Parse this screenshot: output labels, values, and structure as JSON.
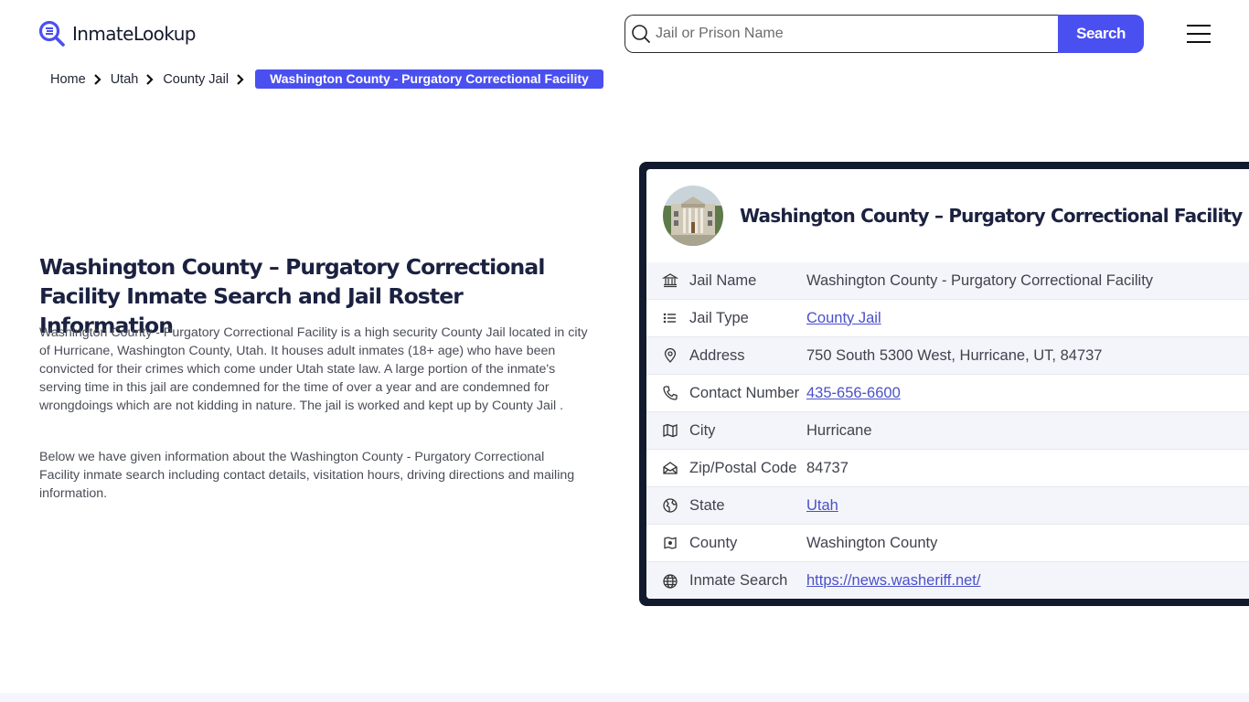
{
  "header": {
    "logo_text": "InmateLookup",
    "search_placeholder": "Jail or Prison Name",
    "search_value": "",
    "search_button": "Search",
    "brand_color": "#4a50f0"
  },
  "breadcrumb": {
    "items": [
      "Home",
      "Utah",
      "County Jail"
    ],
    "current": "Washington County - Purgatory Correctional Facility"
  },
  "main": {
    "title": "Washington County – Purgatory Correctional Facility Inmate Search and Jail Roster Information",
    "paragraphs": [
      "Washington County - Purgatory Correctional Facility is a high security County Jail located in city of Hurricane, Washington County, Utah. It houses adult inmates (18+ age) who have been convicted for their crimes which come under Utah state law. A large portion of the inmate's serving time in this jail are condemned for the time of over a year and are condemned for wrongdoings which are not kidding in nature. The jail is worked and kept up by County Jail .",
      "Below we have given information about the Washington County - Purgatory Correctional Facility inmate search including contact details, visitation hours, driving directions and mailing information."
    ]
  },
  "card": {
    "title": "Washington County – Purgatory Correctional Facility",
    "image_alt": "courthouse-photo",
    "rows": [
      {
        "icon": "bank-icon",
        "label": "Jail Name",
        "value": "Washington County - Purgatory Correctional Facility",
        "link": false
      },
      {
        "icon": "list-icon",
        "label": "Jail Type",
        "value": "County Jail",
        "link": true
      },
      {
        "icon": "map-pin-icon",
        "label": "Address",
        "value": "750 South 5300 West, Hurricane, UT, 84737",
        "link": false
      },
      {
        "icon": "phone-icon",
        "label": "Contact Number",
        "value": "435-656-6600",
        "link": true
      },
      {
        "icon": "map-icon",
        "label": "City",
        "value": "Hurricane",
        "link": false
      },
      {
        "icon": "mail-open-icon",
        "label": "Zip/Postal Code",
        "value": "84737",
        "link": false
      },
      {
        "icon": "globe-region-icon",
        "label": "State",
        "value": "Utah",
        "link": true
      },
      {
        "icon": "county-map-icon",
        "label": "County",
        "value": "Washington County",
        "link": false
      },
      {
        "icon": "globe-icon",
        "label": "Inmate Search",
        "value": "https://news.washeriff.net/",
        "link": true
      }
    ]
  }
}
